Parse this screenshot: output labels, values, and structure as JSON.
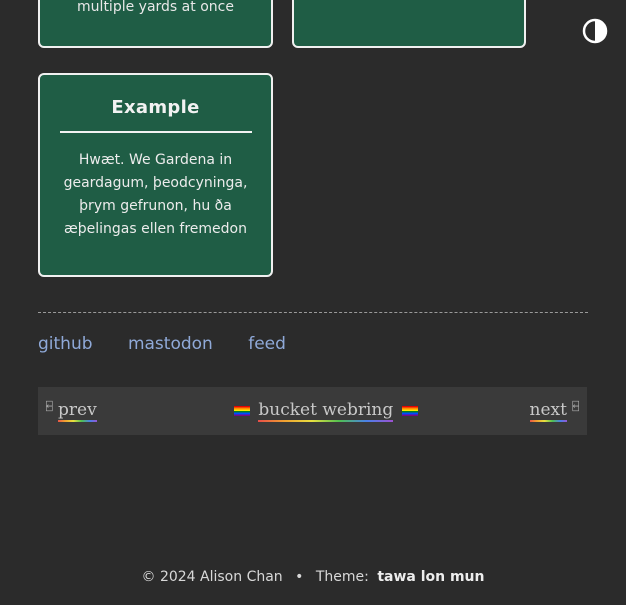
{
  "cards": {
    "partial_1_text": "multiple yards at once",
    "example_title": "Example",
    "example_body": "Hwæt. We Gardena in geardagum, þeodcyninga, þrym gefrunon, hu ða æþelingas ellen fremedon"
  },
  "theme_toggle": {
    "icon": "half-circle-contrast-icon"
  },
  "links": [
    {
      "label": "github"
    },
    {
      "label": "mastodon"
    },
    {
      "label": "feed"
    }
  ],
  "webring": {
    "prev_label": "prev",
    "center_label": "bucket webring",
    "next_label": "next",
    "arrow_glyph": "⍇"
  },
  "footer": {
    "copyright": "© 2024 Alison Chan",
    "separator": "•",
    "theme_label": "Theme:",
    "theme_name": "tawa lon mun"
  },
  "colors": {
    "background": "#2b2b2b",
    "card_bg": "#1f5d45",
    "link": "#8fa9d8"
  }
}
